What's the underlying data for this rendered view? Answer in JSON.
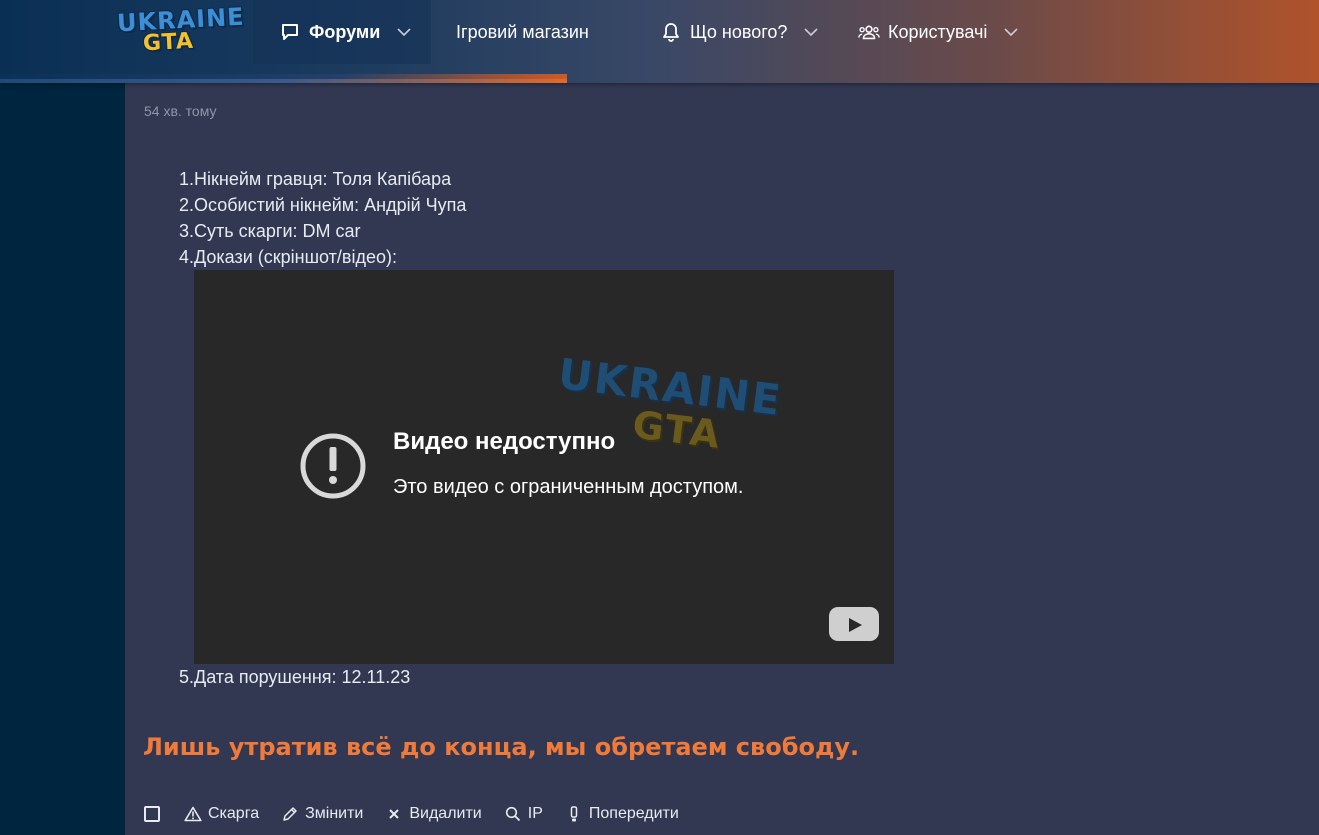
{
  "logo": {
    "line1": "UKRAINE",
    "line2": "GTA"
  },
  "nav": {
    "forums": {
      "label": "Форуми",
      "icon": "chat-bubble-icon",
      "has_dropdown": true
    },
    "shop": {
      "label": "Ігровий магазин"
    },
    "whats_new": {
      "label": "Що нового?",
      "icon": "bell-icon",
      "has_dropdown": true
    },
    "users": {
      "label": "Користувачі",
      "icon": "users-icon",
      "has_dropdown": true
    }
  },
  "post": {
    "timestamp": "54 хв. тому",
    "items": [
      {
        "num": "1.",
        "text": "Нікнейм гравця: Толя Капібара"
      },
      {
        "num": "2.",
        "text": "Особистий нікнейм: Андрій Чупа"
      },
      {
        "num": "3.",
        "text": "Суть скарги: DM car"
      },
      {
        "num": "4.",
        "text": "Докази (скріншот/відео):"
      }
    ],
    "video": {
      "watermark_line1": "UKRAINE",
      "watermark_line2": "GTA",
      "title": "Видео недоступно",
      "subtitle": "Это видео с ограниченным доступом."
    },
    "item5": {
      "num": "5.",
      "text": "Дата порушення: 12.11.23"
    },
    "signature": "Лишь утратив всё до конца, мы обретаем свободу."
  },
  "actions": {
    "report": "Скарга",
    "edit": "Змінити",
    "delete": "Видалити",
    "ip": "IP",
    "warn": "Попередити"
  },
  "colors": {
    "background": "#323852",
    "left_strip": "#00253f",
    "signature": "#f07a3a",
    "header_accent": "#e06a2a"
  }
}
